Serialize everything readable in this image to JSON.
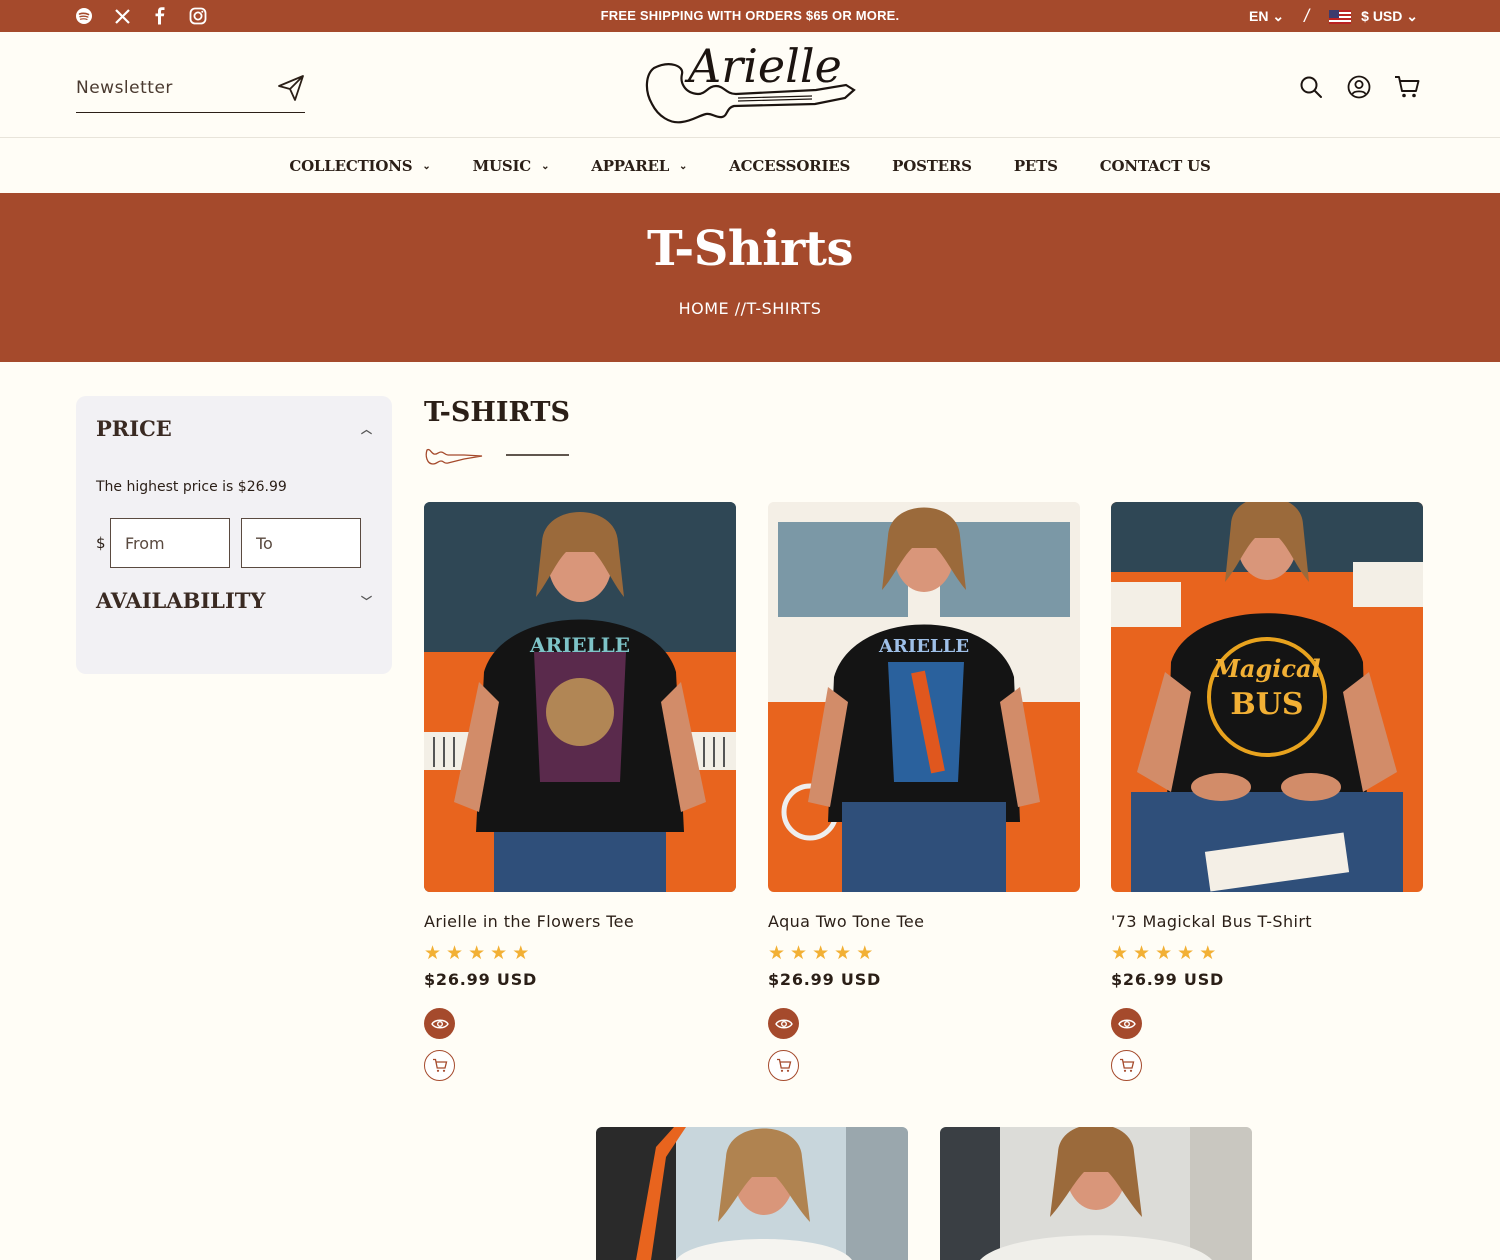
{
  "announcement": {
    "message": "FREE SHIPPING WITH ORDERS $65 OR MORE.",
    "language": "EN",
    "separator": "/",
    "currency": "$ USD",
    "socials": [
      "spotify-icon",
      "x-icon",
      "facebook-icon",
      "instagram-icon"
    ]
  },
  "header": {
    "newsletter_placeholder": "Newsletter",
    "logo_text": "Arielle",
    "icons": [
      "search-icon",
      "account-icon",
      "cart-icon"
    ]
  },
  "nav": {
    "items": [
      {
        "label": "COLLECTIONS",
        "dropdown": true
      },
      {
        "label": "MUSIC",
        "dropdown": true
      },
      {
        "label": "APPAREL",
        "dropdown": true
      },
      {
        "label": "ACCESSORIES",
        "dropdown": false
      },
      {
        "label": "POSTERS",
        "dropdown": false
      },
      {
        "label": "PETS",
        "dropdown": false
      },
      {
        "label": "CONTACT US",
        "dropdown": false
      }
    ]
  },
  "hero": {
    "title": "T-Shirts",
    "breadcrumb": "HOME //T-SHIRTS"
  },
  "filters": {
    "price_title": "PRICE",
    "price_note": "The highest price is $26.99",
    "currency_symbol": "$",
    "from_placeholder": "From",
    "to_placeholder": "To",
    "availability_title": "AVAILABILITY"
  },
  "collection": {
    "title": "T-SHIRTS",
    "products": [
      {
        "name": "Arielle in the Flowers Tee",
        "price": "$26.99 USD",
        "rating": 5
      },
      {
        "name": "Aqua Two Tone Tee",
        "price": "$26.99 USD",
        "rating": 5
      },
      {
        "name": "'73 Magickal Bus T-Shirt",
        "price": "$26.99 USD",
        "rating": 5
      }
    ]
  },
  "colors": {
    "brand": "#a54a2c",
    "star": "#f2b035",
    "background": "#fffdf6"
  }
}
